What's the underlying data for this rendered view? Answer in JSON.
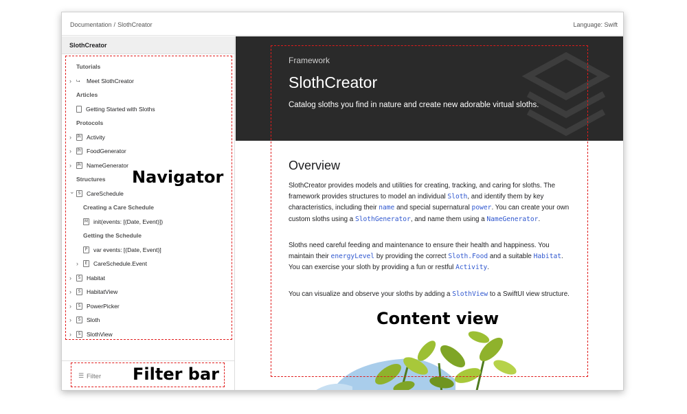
{
  "topbar": {
    "breadcrumb": [
      "Documentation",
      "SlothCreator"
    ],
    "breadcrumb_separator": "/",
    "language": "Language: Swift"
  },
  "sidebar": {
    "title": "SlothCreator",
    "items": [
      {
        "kind": "group",
        "label": "Tutorials"
      },
      {
        "kind": "item",
        "label": "Meet SlothCreator",
        "icon": "tutorial-icon",
        "chevron": "right"
      },
      {
        "kind": "group",
        "label": "Articles"
      },
      {
        "kind": "item",
        "label": "Getting Started with Sloths",
        "icon": "article-icon"
      },
      {
        "kind": "group",
        "label": "Protocols"
      },
      {
        "kind": "item",
        "label": "Activity",
        "icon": "protocol-icon",
        "symbol": "Pr",
        "chevron": "right"
      },
      {
        "kind": "item",
        "label": "FoodGenerator",
        "icon": "protocol-icon",
        "symbol": "Pr",
        "chevron": "right"
      },
      {
        "kind": "item",
        "label": "NameGenerator",
        "icon": "protocol-icon",
        "symbol": "Pr",
        "chevron": "right"
      },
      {
        "kind": "group",
        "label": "Structures"
      },
      {
        "kind": "item",
        "label": "CareSchedule",
        "icon": "structure-icon",
        "symbol": "S",
        "chevron": "down"
      },
      {
        "kind": "subgroup",
        "label": "Creating a Care Schedule"
      },
      {
        "kind": "subitem",
        "label": "init(events: [(Date, Event)])",
        "icon": "method-icon",
        "symbol": "M"
      },
      {
        "kind": "subgroup",
        "label": "Getting the Schedule"
      },
      {
        "kind": "subitem",
        "label": "var events: [(Date, Event)]",
        "icon": "property-icon",
        "symbol": "P"
      },
      {
        "kind": "subitem",
        "label": "CareSchedule.Event",
        "icon": "enum-icon",
        "symbol": "E",
        "chevron": "right"
      },
      {
        "kind": "item",
        "label": "Habitat",
        "icon": "structure-icon",
        "symbol": "S",
        "chevron": "right"
      },
      {
        "kind": "item",
        "label": "HabitatView",
        "icon": "structure-icon",
        "symbol": "S",
        "chevron": "right"
      },
      {
        "kind": "item",
        "label": "PowerPicker",
        "icon": "structure-icon",
        "symbol": "S",
        "chevron": "right"
      },
      {
        "kind": "item",
        "label": "Sloth",
        "icon": "structure-icon",
        "symbol": "S",
        "chevron": "right"
      },
      {
        "kind": "item",
        "label": "SlothView",
        "icon": "structure-icon",
        "symbol": "S",
        "chevron": "right"
      }
    ],
    "filter_placeholder": "Filter",
    "filter_icon": "filter-icon"
  },
  "hero": {
    "eyebrow": "Framework",
    "title": "SlothCreator",
    "description": "Catalog sloths you find in nature and create new adorable virtual sloths."
  },
  "overview": {
    "title": "Overview",
    "paragraphs": [
      [
        {
          "t": "SlothCreator provides models and utilities for creating, tracking, and caring for sloths. The framework provides structures to model an individual "
        },
        {
          "code": "Sloth"
        },
        {
          "t": ", and identify them by key characteristics, including their "
        },
        {
          "code": "name"
        },
        {
          "t": " and special supernatural "
        },
        {
          "code": "power"
        },
        {
          "t": ". You can create your own custom sloths using a "
        },
        {
          "code": "SlothGenerator"
        },
        {
          "t": ", and name them using a "
        },
        {
          "code": "NameGenerator"
        },
        {
          "t": "."
        }
      ],
      [
        {
          "t": "Sloths need careful feeding and maintenance to ensure their health and happiness. You maintain their "
        },
        {
          "code": "energyLevel"
        },
        {
          "t": " by providing the correct "
        },
        {
          "code": "Sloth.Food"
        },
        {
          "t": " and a suitable "
        },
        {
          "code": "Habitat"
        },
        {
          "t": ". You can exercise your sloth by providing a fun or restful "
        },
        {
          "code": "Activity"
        },
        {
          "t": "."
        }
      ],
      [
        {
          "t": "You can visualize and observe your sloths by adding a "
        },
        {
          "code": "SlothView"
        },
        {
          "t": " to a SwiftUI view structure."
        }
      ]
    ]
  },
  "annotations": {
    "navigator": "Navigator",
    "filter_bar": "Filter bar",
    "content_view": "Content view",
    "color": "#e01b1b"
  },
  "colors": {
    "hero_background": "#2a2a2a",
    "code_link": "#2f57cf"
  }
}
